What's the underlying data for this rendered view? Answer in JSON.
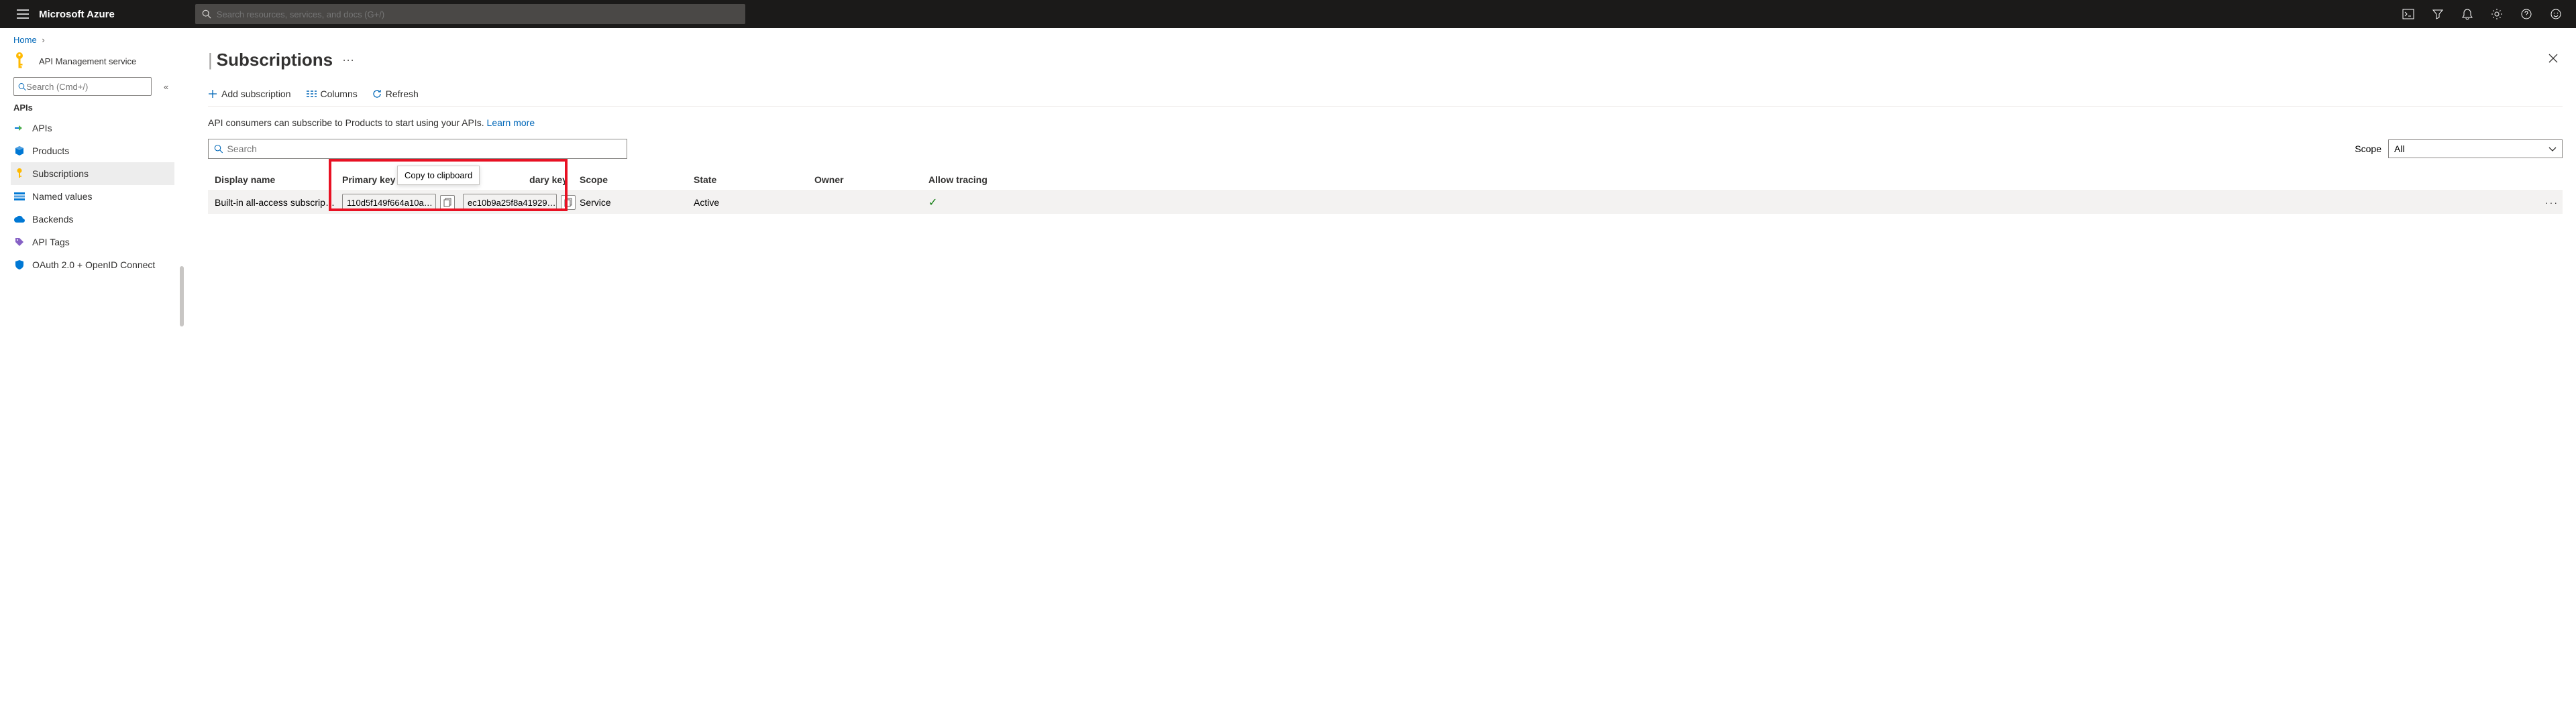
{
  "topbar": {
    "brand": "Microsoft Azure",
    "search_placeholder": "Search resources, services, and docs (G+/)"
  },
  "breadcrumb": {
    "home": "Home"
  },
  "sidebar": {
    "service_label": "API Management service",
    "search_placeholder": "Search (Cmd+/)",
    "collapse_glyph": "«",
    "group_label": "APIs",
    "items": [
      {
        "label": "APIs"
      },
      {
        "label": "Products"
      },
      {
        "label": "Subscriptions"
      },
      {
        "label": "Named values"
      },
      {
        "label": "Backends"
      },
      {
        "label": "API Tags"
      },
      {
        "label": "OAuth 2.0 + OpenID Connect"
      }
    ]
  },
  "page": {
    "pipe": "|",
    "title": "Subscriptions",
    "more": "···"
  },
  "toolbar": {
    "add": "Add subscription",
    "columns": "Columns",
    "refresh": "Refresh"
  },
  "info": {
    "text": "API consumers can subscribe to Products to start using your APIs. ",
    "link": "Learn more"
  },
  "filter": {
    "search_placeholder": "Search",
    "scope_label": "Scope",
    "scope_value": "All"
  },
  "table": {
    "headers": {
      "display_name": "Display name",
      "primary_key": "Primary key",
      "secondary_key_suffix": "dary key",
      "scope": "Scope",
      "state": "State",
      "owner": "Owner",
      "allow_tracing": "Allow tracing"
    },
    "rows": [
      {
        "display_name": "Built-in all-access subscrip…",
        "primary_key": "110d5f149f664a10a…",
        "secondary_key": "ec10b9a25f8a41929…",
        "scope": "Service",
        "state": "Active",
        "owner": "",
        "allow_tracing": "✓",
        "more": "···"
      }
    ]
  },
  "tooltip": {
    "copy": "Copy to clipboard"
  }
}
